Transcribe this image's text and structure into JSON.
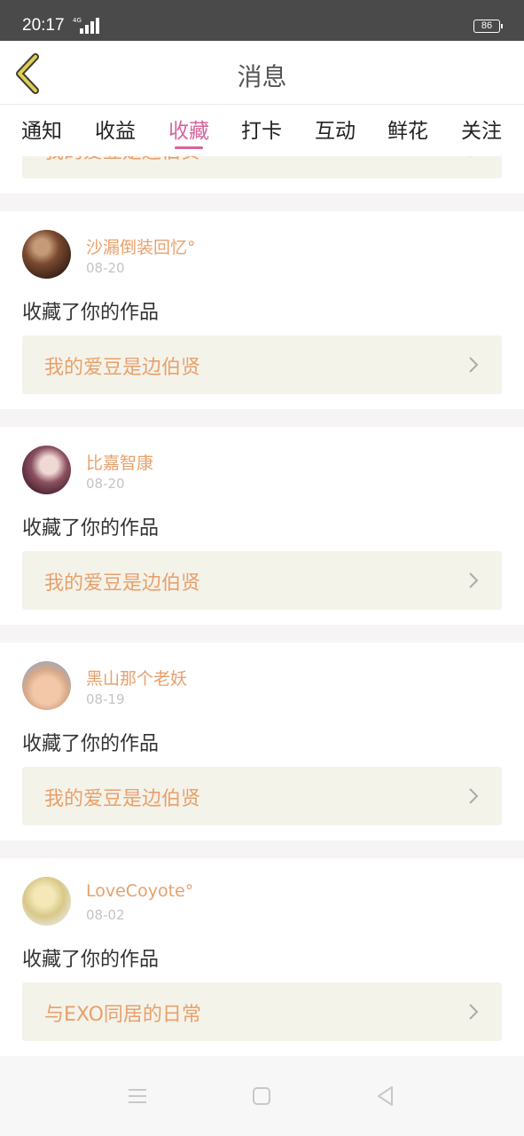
{
  "status_bar": {
    "time": "20:17",
    "network": "4G",
    "battery": "86"
  },
  "header": {
    "title": "消息"
  },
  "tabs": [
    {
      "label": "通知"
    },
    {
      "label": "收益"
    },
    {
      "label": "收藏"
    },
    {
      "label": "打卡"
    },
    {
      "label": "互动"
    },
    {
      "label": "鲜花"
    },
    {
      "label": "关注"
    }
  ],
  "active_tab": "收藏",
  "partial_card": {
    "work_title": "我的爱豆是边伯贤"
  },
  "notifications": [
    {
      "username": "沙漏倒装回忆°",
      "date": "08-20",
      "action": "收藏了你的作品",
      "work_title": "我的爱豆是边伯贤"
    },
    {
      "username": "比嘉智康",
      "date": "08-20",
      "action": "收藏了你的作品",
      "work_title": "我的爱豆是边伯贤"
    },
    {
      "username": "黑山那个老妖",
      "date": "08-19",
      "action": "收藏了你的作品",
      "work_title": "我的爱豆是边伯贤"
    },
    {
      "username": "LoveCoyote°",
      "date": "08-02",
      "action": "收藏了你的作品",
      "work_title": "与EXO同居的日常"
    }
  ]
}
